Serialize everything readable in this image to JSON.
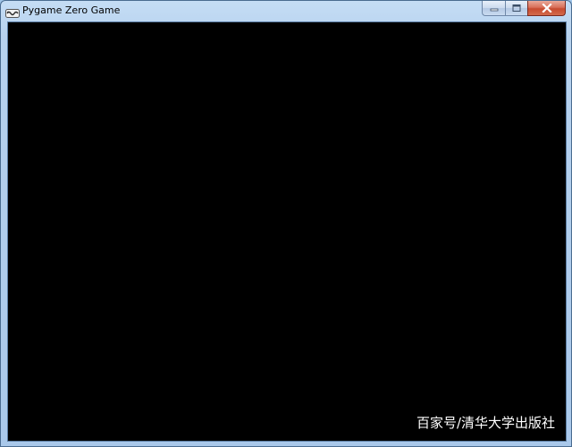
{
  "window": {
    "title": "Pygame Zero Game",
    "app_icon": "pygame-snake-icon"
  },
  "caption_buttons": [
    {
      "name": "minimize",
      "icon": "minimize-icon"
    },
    {
      "name": "maximize",
      "icon": "maximize-icon"
    },
    {
      "name": "close",
      "icon": "close-icon"
    }
  ],
  "canvas": {
    "background_color": "#000000"
  },
  "watermark": {
    "text": "百家号/清华大学出版社"
  },
  "colors": {
    "frame": "#a9c8ea",
    "close_button": "#c74b30"
  }
}
